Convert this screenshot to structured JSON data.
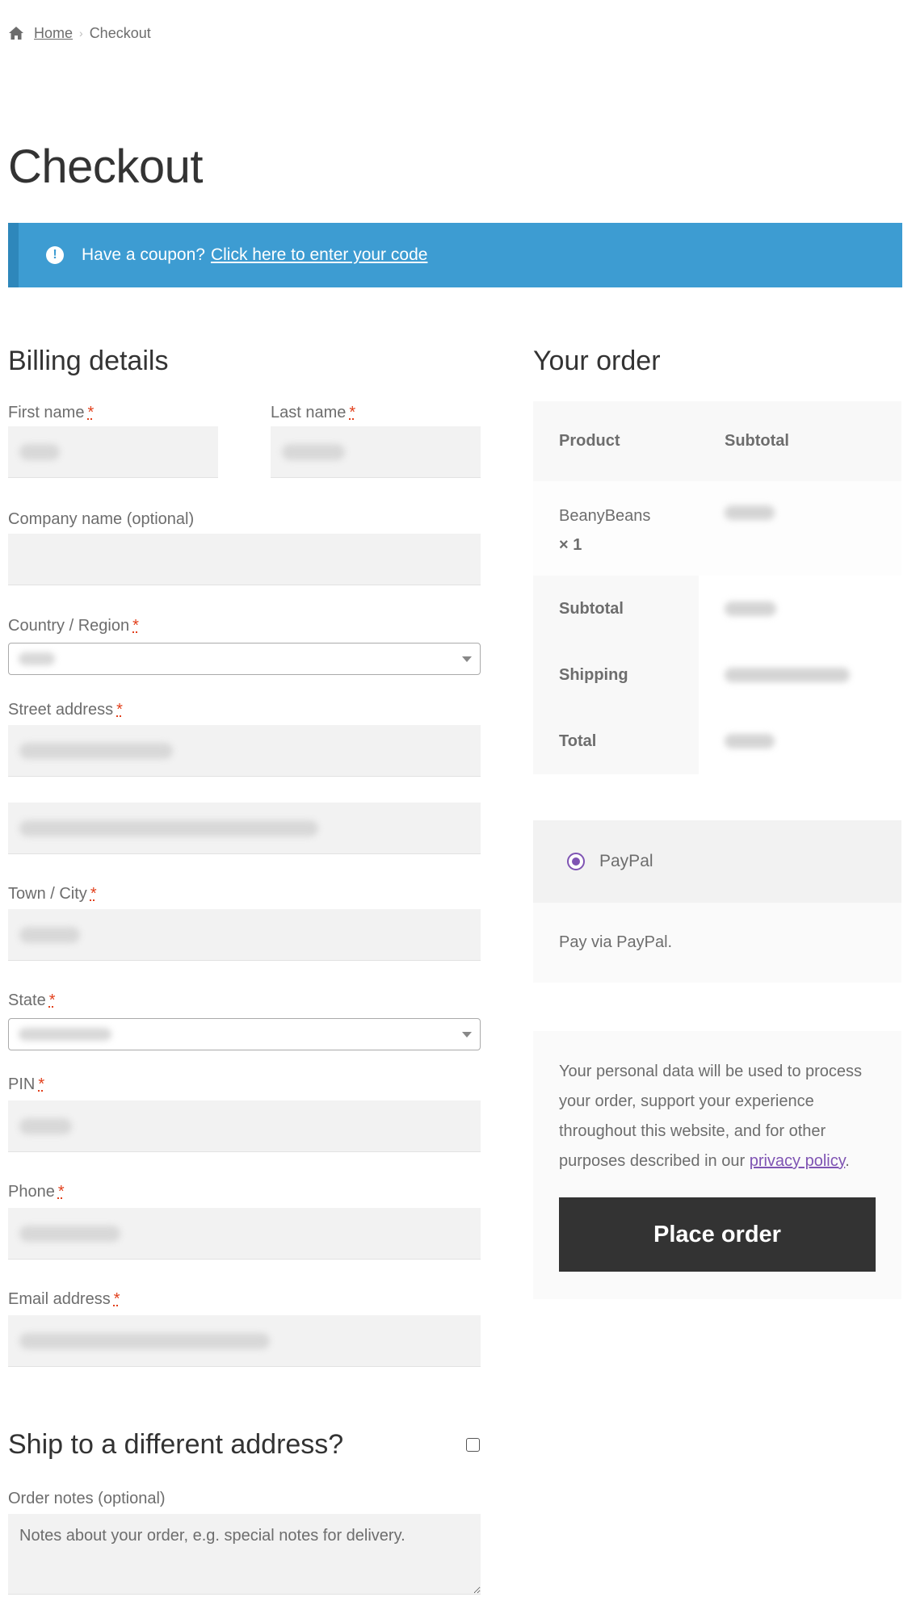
{
  "breadcrumb": {
    "home": "Home",
    "current": "Checkout"
  },
  "page_title": "Checkout",
  "coupon": {
    "text": "Have a coupon?",
    "link": "Click here to enter your code"
  },
  "billing": {
    "title": "Billing details",
    "first_name_label": "First name",
    "last_name_label": "Last name",
    "company_label": "Company name (optional)",
    "country_label": "Country / Region",
    "street_label": "Street address",
    "town_label": "Town / City",
    "state_label": "State",
    "pin_label": "PIN",
    "phone_label": "Phone",
    "email_label": "Email address",
    "required_mark": "*"
  },
  "shipping": {
    "title": "Ship to a different address?"
  },
  "notes": {
    "label": "Order notes (optional)",
    "placeholder": "Notes about your order, e.g. special notes for delivery."
  },
  "order": {
    "title": "Your order",
    "col_product": "Product",
    "col_subtotal": "Subtotal",
    "item_name": "BeanyBeans",
    "item_qty": "× 1",
    "subtotal_label": "Subtotal",
    "shipping_label": "Shipping",
    "total_label": "Total"
  },
  "payment": {
    "method": "PayPal",
    "description": "Pay via PayPal."
  },
  "privacy": {
    "text": "Your personal data will be used to process your order, support your experience throughout this website, and for other purposes described in our ",
    "link": "privacy policy",
    "end": "."
  },
  "place_order": "Place order",
  "colors": {
    "notice": "#3d9cd2",
    "accent": "#7f54b3",
    "button": "#333333",
    "required": "#e2401c"
  }
}
